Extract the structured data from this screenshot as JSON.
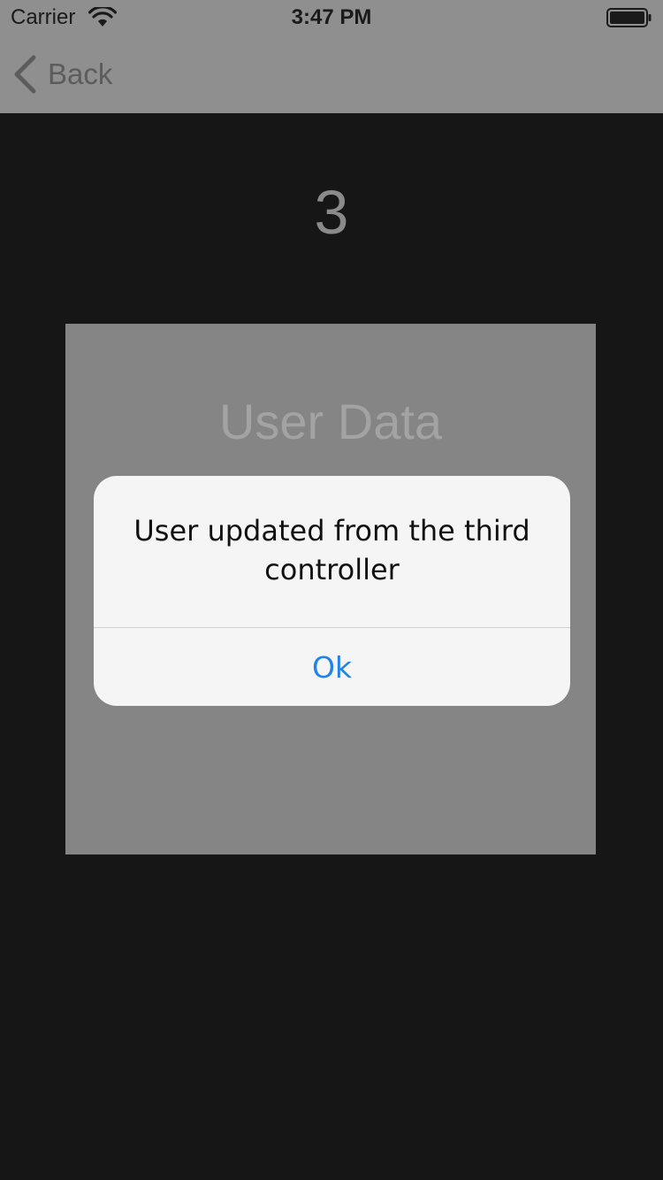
{
  "status_bar": {
    "carrier": "Carrier",
    "time": "3:47 PM",
    "wifi_icon": "wifi-icon",
    "battery_icon": "battery-icon"
  },
  "nav": {
    "back_label": "Back",
    "back_icon": "chevron-left-icon"
  },
  "content": {
    "page_number": "3",
    "card_title": "User Data"
  },
  "alert": {
    "message": "User updated from the third controller",
    "ok_label": "Ok"
  },
  "colors": {
    "dimmed_bar": "#8f8f8f",
    "background": "#161616",
    "card": "#858585",
    "alert_bg": "#f5f5f5",
    "accent": "#1f84ea"
  }
}
